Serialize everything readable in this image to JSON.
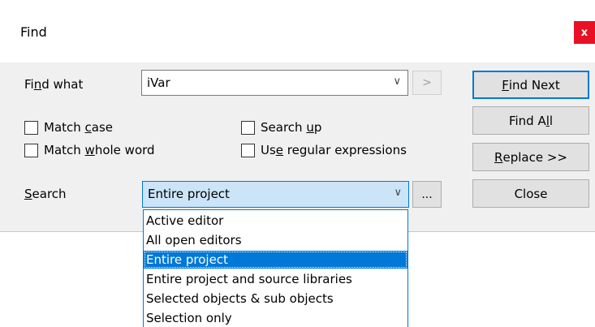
{
  "window": {
    "title": "Find",
    "close_glyph": "x"
  },
  "find_what": {
    "label_pre": "Fi",
    "label_key": "n",
    "label_post": "d what",
    "value": "iVar",
    "next_glyph": ">"
  },
  "options": {
    "match_case": {
      "pre": "Match ",
      "key": "c",
      "post": "ase",
      "checked": false
    },
    "match_whole_word": {
      "pre": "Match ",
      "key": "w",
      "post": "hole word",
      "checked": false
    },
    "search_up": {
      "pre": "Search ",
      "key": "u",
      "post": "p",
      "checked": false
    },
    "use_regex": {
      "pre": "Us",
      "key": "e",
      "post": " regular expressions",
      "checked": false
    }
  },
  "search": {
    "label_key": "S",
    "label_post": "earch",
    "value": "Entire project",
    "browse_label": "...",
    "options": [
      "Active editor",
      "All open editors",
      "Entire project",
      "Entire project and source libraries",
      "Selected objects & sub objects",
      "Selection only"
    ],
    "selected_index": 2
  },
  "buttons": {
    "find_next": {
      "key": "F",
      "post": "ind Next"
    },
    "find_all": {
      "pre": "Find A",
      "key": "l",
      "post": "l"
    },
    "replace": {
      "key": "R",
      "post": "eplace >>"
    },
    "close": {
      "label": "Close"
    }
  },
  "colors": {
    "accent": "#0078d7",
    "close": "#e81123",
    "dialog_bg": "#f0f0f0"
  }
}
